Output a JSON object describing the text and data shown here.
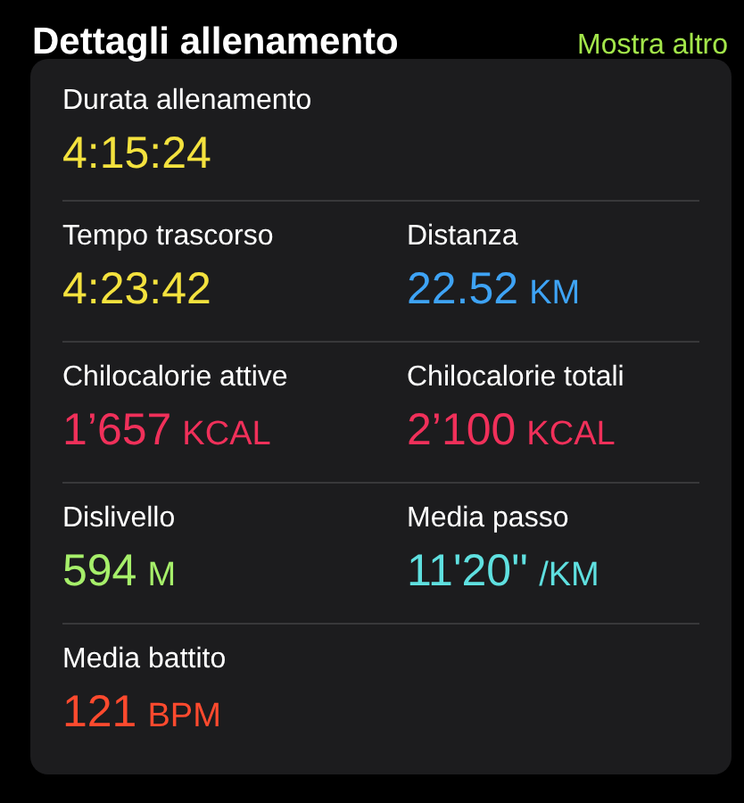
{
  "header": {
    "title": "Dettagli allenamento",
    "link": "Mostra altro"
  },
  "rows": [
    [
      {
        "label": "Durata allenamento",
        "value": "4:15:24",
        "color": "#f4e23e"
      }
    ],
    [
      {
        "label": "Tempo trascorso",
        "value": "4:23:42",
        "color": "#f4e23e"
      },
      {
        "label": "Distanza",
        "value": "22.52",
        "unit": "KM",
        "color": "#3ea3f5"
      }
    ],
    [
      {
        "label": "Chilocalorie attive",
        "value": "1’657",
        "unit": "KCAL",
        "color": "#f0305a"
      },
      {
        "label": "Chilocalorie totali",
        "value": "2’100",
        "unit": "KCAL",
        "color": "#f0305a"
      }
    ],
    [
      {
        "label": "Dislivello",
        "value": "594",
        "unit": "M",
        "color": "#a6ef6a"
      },
      {
        "label": "Media passo",
        "value": "11'20''",
        "unit": "/KM",
        "color": "#5fe0e0"
      }
    ],
    [
      {
        "label": "Media battito",
        "value": "121",
        "unit": "BPM",
        "color": "#ff4a2e"
      }
    ]
  ]
}
